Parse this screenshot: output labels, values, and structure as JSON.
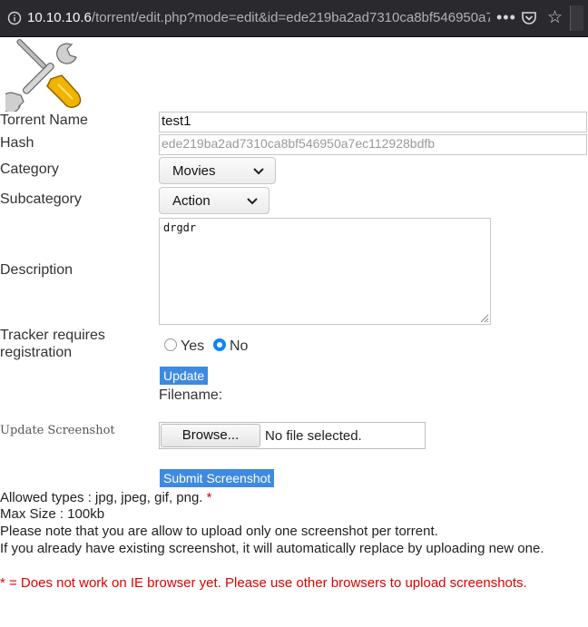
{
  "browser": {
    "url_host": "10.10.10.6",
    "url_path": "/torrent/edit.php?mode=edit&id=ede219ba2ad7310ca8bf546950a7",
    "menu_dots": "•••"
  },
  "form": {
    "torrent_name_label": "Torrent Name",
    "torrent_name_value": "test1",
    "hash_label": "Hash",
    "hash_value": "ede219ba2ad7310ca8bf546950a7ec112928bdfb",
    "category_label": "Category",
    "category_value": "Movies",
    "subcategory_label": "Subcategory",
    "subcategory_value": "Action",
    "description_label": "Description",
    "description_value": "drgdr",
    "tracker_label_line1": "Tracker requires",
    "tracker_label_line2": "registration",
    "tracker_options": [
      "Yes",
      "No"
    ],
    "tracker_selected": "No",
    "update_button": "Update",
    "filename_label": "Filename:"
  },
  "screenshot": {
    "label": "Update Screenshot",
    "browse_button": "Browse...",
    "file_status": "No file selected.",
    "submit_button": "Submit Screenshot",
    "allowed_types": "Allowed types : jpg, jpeg, gif, png.",
    "asterisk": "*",
    "max_size": "Max Size : 100kb",
    "note_one": "Please note that you are allow to upload only one screenshot per torrent.",
    "note_replace": "If you already have existing screenshot, it will automatically replace by uploading new one.",
    "ie_warning": "* = Does not work on IE browser yet. Please use other browsers to upload screenshots."
  },
  "colors": {
    "accent_blue": "#3d8ae0",
    "radio_blue": "#0a84ff",
    "warning_red": "#e00000",
    "toolbar_bg": "#2a2a2e"
  },
  "icons": [
    "info-icon",
    "pocket-icon",
    "bookmark-star-icon",
    "tools-logo-icon"
  ]
}
